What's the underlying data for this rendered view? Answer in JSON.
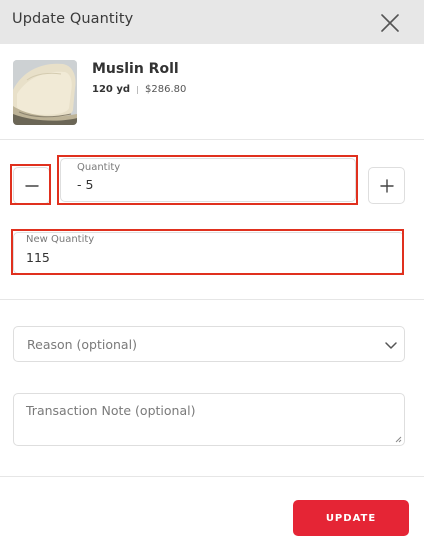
{
  "dialog": {
    "title": "Update Quantity",
    "close_icon": "close-icon"
  },
  "product": {
    "name": "Muslin Roll",
    "quantity": "120 yd",
    "price": "$286.80",
    "thumbnail": "folded-fabric-image"
  },
  "stepper": {
    "minus_label": "−",
    "plus_label": "+"
  },
  "quantity_field": {
    "label": "Quantity",
    "value": "- 5"
  },
  "new_quantity_field": {
    "label": "New Quantity",
    "value": "115"
  },
  "reason": {
    "placeholder": "Reason (optional)",
    "icon": "chevron-down-icon"
  },
  "note": {
    "placeholder": "Transaction Note (optional)"
  },
  "actions": {
    "update_label": "UPDATE"
  },
  "colors": {
    "header_bg": "#e7e7e7",
    "primary": "#e52535",
    "highlight": "#e0301e"
  }
}
